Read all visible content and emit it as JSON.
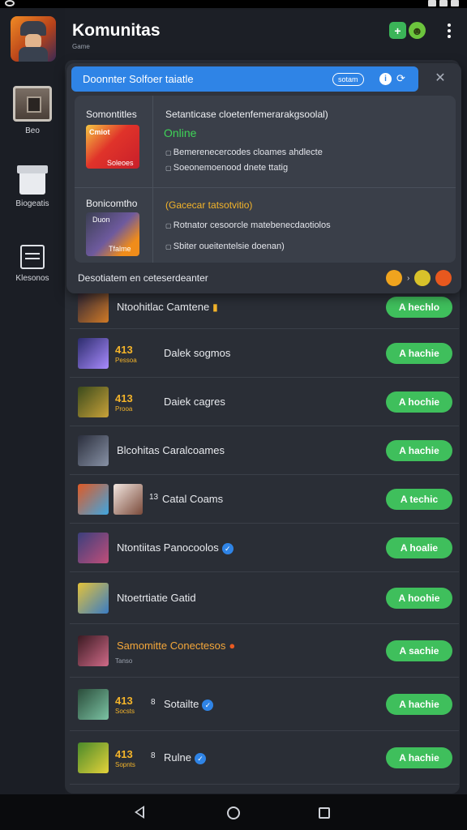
{
  "app": {
    "title": "Komunitas",
    "subtitle": "Game"
  },
  "sidebar": {
    "items": [
      {
        "label": "Beo",
        "icon": "chest-icon"
      },
      {
        "label": "Biogeatis",
        "icon": "box-icon"
      },
      {
        "label": "Klesonos",
        "icon": "stack-icon"
      }
    ]
  },
  "header": {
    "add_button": "+",
    "emoji_button": "☻"
  },
  "search": {
    "text": "Doonnter Solfoer taiatle",
    "chip": "sotam",
    "info": "i"
  },
  "popup": {
    "section1": {
      "label": "Somontitles",
      "art_chip": "Cmiot",
      "art_sub": "Soleoes",
      "title": "Setanticase cloetenfemerarakgsoolal)",
      "status": "Online",
      "bullets": [
        "Bemerenecercodes cloames ahdlecte",
        "Soeonemoenood dnete ttatig"
      ]
    },
    "section2": {
      "label": "Bonicomtho",
      "art_chip": "Duon",
      "art_sub": "Tfalme",
      "title": "(Gacecar tatsotvitio)",
      "bullets": [
        "Rotnator cesoorcle matebenecdaotiolos",
        "Sbiter oueitentelsie doenan)"
      ]
    },
    "footer": "Desotiatem en ceteserdeanter"
  },
  "rows": [
    {
      "title": "Ntoohitlac Camtene",
      "suffix": "trophy",
      "button": "A hechlo",
      "colors": [
        "#2a2436",
        "#d17a26"
      ]
    },
    {
      "badge": "413",
      "badge_sub": "Pessoa",
      "title": "Dalek sogmos",
      "button": "A hachie",
      "colors": [
        "#2c2c6c",
        "#a98bff"
      ]
    },
    {
      "badge": "413",
      "badge_sub": "Prooa",
      "title": "Daiek cagres",
      "button": "A hochie",
      "colors": [
        "#3a4a1c",
        "#c9a239"
      ]
    },
    {
      "title": "Blcohitas Caralcoames",
      "button": "A hachie",
      "colors": [
        "#2a2e3c",
        "#8892a6"
      ]
    },
    {
      "title": "Catal Coams",
      "prefix": "13",
      "button": "A techic",
      "colors": [
        "#e05a25",
        "#3fa6e0"
      ],
      "double": true
    },
    {
      "title": "Ntontiitas Panocoolos",
      "verified": true,
      "button": "A hoalie",
      "colors": [
        "#3b3f7c",
        "#c04e7a"
      ]
    },
    {
      "title": "Ntoetrtiatie Gatid",
      "button": "A hoohie",
      "colors": [
        "#e4c23a",
        "#3a7cc4"
      ]
    },
    {
      "title": "Samomitte Conectesos",
      "orange": true,
      "sub": "Tanso",
      "button": "A sachie",
      "colors": [
        "#3a1a22",
        "#d06a88"
      ]
    },
    {
      "badge": "413",
      "badge_sub": "Socsts",
      "prefix": "8",
      "title": "Sotailte",
      "verified": true,
      "button": "A hachie",
      "colors": [
        "#2a4c3a",
        "#7cc4a4"
      ]
    },
    {
      "badge": "413",
      "badge_sub": "Sopnts",
      "prefix": "8",
      "title": "Rulne",
      "verified": true,
      "button": "A hachie",
      "colors": [
        "#4a8a2a",
        "#e4d23a"
      ]
    }
  ]
}
